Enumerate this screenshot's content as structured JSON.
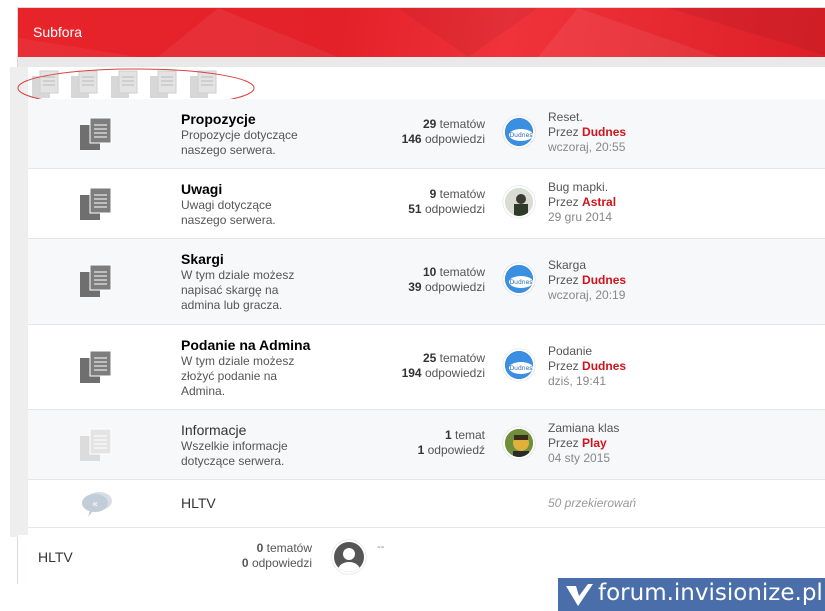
{
  "header": {
    "title": "Subfora"
  },
  "forums": [
    {
      "name": "Propozycje",
      "desc": [
        "Propozycje dotyczące",
        "naszego serwera."
      ],
      "topics": "29",
      "topics_label": "tematów",
      "replies": "146",
      "replies_label": "odpowiedzi",
      "last_title": "Reset.",
      "last_by": "Przez",
      "last_user": "Dudnes",
      "last_date": "wczoraj, 20:55"
    },
    {
      "name": "Uwagi",
      "desc": [
        "Uwagi dotyczące",
        "naszego serwera."
      ],
      "topics": "9",
      "topics_label": "tematów",
      "replies": "51",
      "replies_label": "odpowiedzi",
      "last_title": "Bug mapki.",
      "last_by": "Przez",
      "last_user": "Astral",
      "last_date": "29 gru 2014"
    },
    {
      "name": "Skargi",
      "desc": [
        "W tym dziale możesz",
        "napisać skargę na",
        "admina lub gracza."
      ],
      "topics": "10",
      "topics_label": "tematów",
      "replies": "39",
      "replies_label": "odpowiedzi",
      "last_title": "Skarga",
      "last_by": "Przez",
      "last_user": "Dudnes",
      "last_date": "wczoraj, 20:19"
    },
    {
      "name": "Podanie na Admina",
      "desc": [
        "W tym dziale możesz",
        "złożyć podanie na",
        "Admina."
      ],
      "topics": "25",
      "topics_label": "tematów",
      "replies": "194",
      "replies_label": "odpowiedzi",
      "last_title": "Podanie",
      "last_by": "Przez",
      "last_user": "Dudnes",
      "last_date": "dziś, 19:41"
    },
    {
      "name": "Informacje",
      "desc": [
        "Wszelkie informacje",
        "dotyczące serwera."
      ],
      "topics": "1",
      "topics_label": "temat",
      "replies": "1",
      "replies_label": "odpowiedź",
      "last_title": "Zamiana klas",
      "last_by": "Przez",
      "last_user": "Play",
      "last_date": "04 sty 2015"
    }
  ],
  "redirect": {
    "name": "HLTV",
    "count": "50 przekierowań"
  },
  "footer": {
    "name": "HLTV",
    "topics": "0",
    "topics_label": "tematów",
    "replies": "0",
    "replies_label": "odpowiedzi",
    "last": "--"
  },
  "avatar_labels": {
    "dudnes": "Dudnes"
  },
  "watermark": {
    "text": "forum.invisionize.pl"
  },
  "colors": {
    "accent": "#e32129",
    "username": "#d0141c",
    "watermark_bg": "#4a6ea9"
  },
  "icons": {
    "forum": "documents-icon",
    "redirect": "speech-bubble-icon",
    "user": "user-silhouette-icon"
  }
}
